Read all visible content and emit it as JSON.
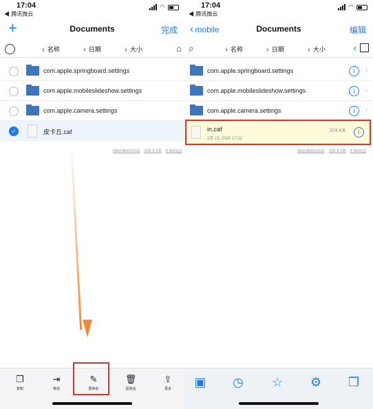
{
  "left": {
    "status": {
      "time": "17:04",
      "carrier": "◀ 腾讯微云"
    },
    "nav": {
      "add": "+",
      "title": "Documents",
      "done": "完成"
    },
    "sort": {
      "name": "名称",
      "date": "日期",
      "size": "大小"
    },
    "files": [
      {
        "name": "com.apple.springboard.settings"
      },
      {
        "name": "com.apple.mobileslideshow.settings"
      },
      {
        "name": "com.apple.camera.settings"
      },
      {
        "name": "皮卡丘.caf"
      }
    ],
    "footer": {
      "path": "/dev/disk0s1s2",
      "free": "158.3 GB",
      "items": "4 item(s)"
    },
    "toolbar": [
      {
        "icon": "❐",
        "label": "复制"
      },
      {
        "icon": "⇥",
        "label": "移动"
      },
      {
        "icon": "✎",
        "label": "重命名"
      },
      {
        "icon": "🗑",
        "label": "回收站"
      },
      {
        "icon": "⇪",
        "label": "更多"
      }
    ]
  },
  "right": {
    "status": {
      "time": "17:04",
      "carrier": "◀ 腾讯微云"
    },
    "nav": {
      "back": "mobile",
      "title": "Documents",
      "edit": "编辑"
    },
    "sort": {
      "name": "名称",
      "date": "日期",
      "size": "大小"
    },
    "files": [
      {
        "name": "com.apple.springboard.settings"
      },
      {
        "name": "com.apple.mobileslideshow.settings"
      },
      {
        "name": "com.apple.camera.settings"
      },
      {
        "name": "in.caf",
        "date": "2月 15, 2020 17:02",
        "size": "374 KB"
      }
    ],
    "footer": {
      "path": "/dev/disk0s1s2",
      "free": "158.3 GB",
      "items": "4 item(s)"
    }
  },
  "colors": {
    "accent": "#1a7cf4",
    "highlight": "#d6332f",
    "arrow": "#f08a3c",
    "selected_row": "#fdfbd9"
  }
}
